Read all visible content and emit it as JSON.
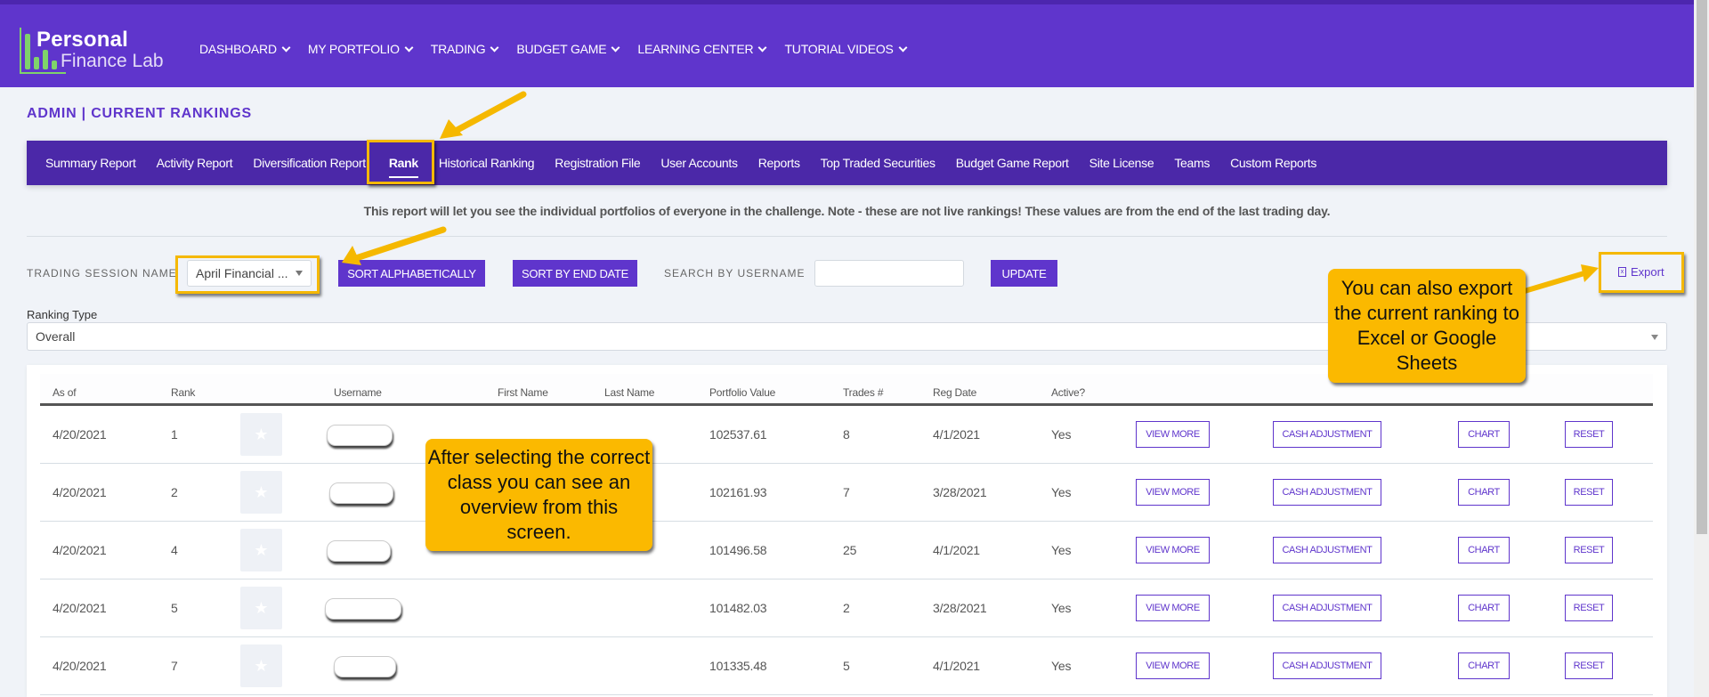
{
  "brand": {
    "line1": "Personal",
    "line2": "Finance Lab"
  },
  "main_nav": [
    {
      "label": "DASHBOARD"
    },
    {
      "label": "MY PORTFOLIO"
    },
    {
      "label": "TRADING"
    },
    {
      "label": "BUDGET GAME"
    },
    {
      "label": "LEARNING CENTER"
    },
    {
      "label": "TUTORIAL VIDEOS"
    }
  ],
  "page_title": "ADMIN | CURRENT RANKINGS",
  "sub_nav": [
    {
      "label": "Summary Report",
      "active": false
    },
    {
      "label": "Activity Report",
      "active": false
    },
    {
      "label": "Diversification Report",
      "active": false
    },
    {
      "label": "Rank",
      "active": true
    },
    {
      "label": "Historical Ranking",
      "active": false
    },
    {
      "label": "Registration File",
      "active": false
    },
    {
      "label": "User Accounts",
      "active": false
    },
    {
      "label": "Reports",
      "active": false
    },
    {
      "label": "Top Traded Securities",
      "active": false
    },
    {
      "label": "Budget Game Report",
      "active": false
    },
    {
      "label": "Site License",
      "active": false
    },
    {
      "label": "Teams",
      "active": false
    },
    {
      "label": "Custom Reports",
      "active": false
    }
  ],
  "notice": "This report will let you see the individual portfolios of everyone in the challenge. Note - these are not live rankings! These values are from the end of the last trading day.",
  "controls": {
    "session_label": "TRADING SESSION NAME",
    "session_value": "April Financial ...",
    "sort_alpha": "SORT ALPHABETICALLY",
    "sort_end": "SORT BY END DATE",
    "search_label": "SEARCH BY USERNAME",
    "search_value": "",
    "update": "UPDATE",
    "export": "Export",
    "ranking_type_label": "Ranking Type",
    "ranking_type_value": "Overall"
  },
  "table": {
    "headers": {
      "as_of": "As of",
      "rank": "Rank",
      "username": "Username",
      "first_name": "First Name",
      "last_name": "Last Name",
      "portfolio_value": "Portfolio Value",
      "trades": "Trades #",
      "reg_date": "Reg Date",
      "active": "Active?"
    },
    "row_buttons": {
      "view_more": "VIEW MORE",
      "cash_adjustment": "CASH ADJUSTMENT",
      "chart": "CHART",
      "reset": "RESET"
    },
    "rows": [
      {
        "as_of": "4/20/2021",
        "rank": "1",
        "username": "",
        "first_name": "",
        "last_name": "",
        "portfolio_value": "102537.61",
        "trades": "8",
        "reg_date": "4/1/2021",
        "active": "Yes"
      },
      {
        "as_of": "4/20/2021",
        "rank": "2",
        "username": "",
        "first_name": "",
        "last_name": "",
        "portfolio_value": "102161.93",
        "trades": "7",
        "reg_date": "3/28/2021",
        "active": "Yes"
      },
      {
        "as_of": "4/20/2021",
        "rank": "4",
        "username": "",
        "first_name": "",
        "last_name": "",
        "portfolio_value": "101496.58",
        "trades": "25",
        "reg_date": "4/1/2021",
        "active": "Yes"
      },
      {
        "as_of": "4/20/2021",
        "rank": "5",
        "username": "",
        "first_name": "",
        "last_name": "",
        "portfolio_value": "101482.03",
        "trades": "2",
        "reg_date": "3/28/2021",
        "active": "Yes"
      },
      {
        "as_of": "4/20/2021",
        "rank": "7",
        "username": "",
        "first_name": "",
        "last_name": "",
        "portfolio_value": "101335.48",
        "trades": "5",
        "reg_date": "4/1/2021",
        "active": "Yes"
      }
    ]
  },
  "annotations": {
    "overview_callout": "After selecting the correct class you can see an overview from this screen.",
    "export_callout": "You can also export the current ranking to Excel or Google Sheets"
  },
  "colors": {
    "brand_purple": "#5f35cc",
    "subnav_purple": "#4b28a8",
    "logo_green": "#7fd36a",
    "callout_yellow": "#fbb900"
  }
}
